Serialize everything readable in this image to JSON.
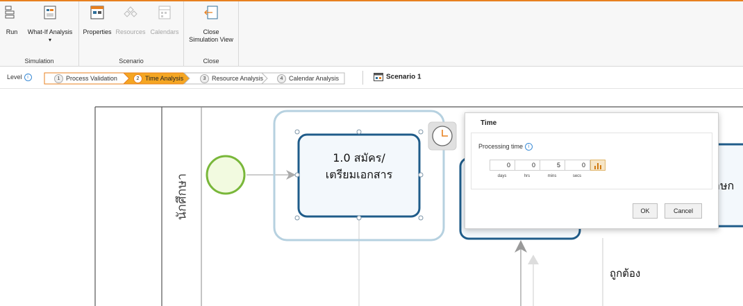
{
  "ribbon": {
    "groups": [
      {
        "label": "Simulation"
      },
      {
        "label": "Scenario"
      },
      {
        "label": "Close"
      }
    ],
    "buttons": {
      "run": "Run",
      "what_if": "What-If Analysis",
      "properties": "Properties",
      "resources": "Resources",
      "calendars": "Calendars",
      "close_line1": "Close",
      "close_line2": "Simulation View"
    },
    "dropdown_arrow": "▾"
  },
  "levelbar": {
    "label": "Level",
    "info": "i",
    "steps": [
      {
        "num": "1",
        "label": "Process Validation"
      },
      {
        "num": "2",
        "label": "Time Analysis"
      },
      {
        "num": "3",
        "label": "Resource Analysis"
      },
      {
        "num": "4",
        "label": "Calendar Analysis"
      }
    ],
    "scenario": "Scenario 1"
  },
  "diagram": {
    "lane_label": "นักศึกษา",
    "task1_line1": "1.0 สมัคร/",
    "task1_line2": "เตรียมเอกสาร",
    "right_partial": "าษก",
    "correct_label": "ถูกต้อง"
  },
  "dialog": {
    "title": "Time",
    "processing_label": "Processing time",
    "info": "i",
    "fields": [
      {
        "value": "0",
        "unit": "days"
      },
      {
        "value": "0",
        "unit": "hrs"
      },
      {
        "value": "5",
        "unit": "mins"
      },
      {
        "value": "0",
        "unit": "secs"
      }
    ],
    "ok": "OK",
    "cancel": "Cancel"
  },
  "colors": {
    "accent_orange": "#e8801f",
    "active_step": "#f5a623",
    "task_border": "#1f5c8a",
    "selection": "#a8c8dc",
    "start_event": "#8bc53f"
  }
}
